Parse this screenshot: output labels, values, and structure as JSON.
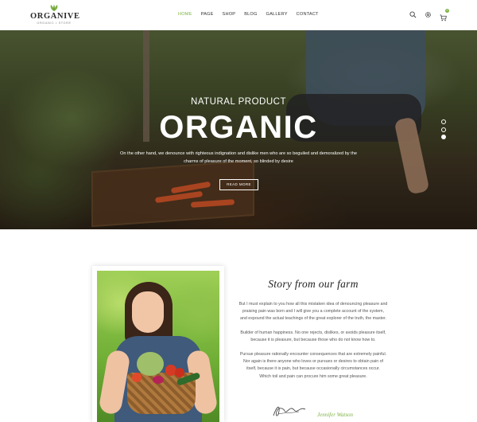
{
  "brand": {
    "name": "ORGANIVE",
    "tagline": "ORGANIC • STORE"
  },
  "nav": {
    "items": [
      {
        "label": "HOME",
        "active": true
      },
      {
        "label": "PAGE"
      },
      {
        "label": "SHOP"
      },
      {
        "label": "BLOG"
      },
      {
        "label": "GALLERY"
      },
      {
        "label": "CONTACT"
      }
    ]
  },
  "header_icons": [
    "search-icon",
    "gear-icon",
    "cart-icon"
  ],
  "cart": {
    "count": "0"
  },
  "hero": {
    "subtitle": "NATURAL PRODUCT",
    "title": "ORGANIC",
    "text": "On the other hand, we denounce with righteous indignation and dislike men who are so beguiled and demoralized by the charms of pleasure of the moment, so blinded by desire",
    "button": "READ MORE",
    "slides": 3,
    "active_slide": 3
  },
  "story": {
    "title": "Story from our farm",
    "p1": "But I must explain to you how all this mistaken idea of denouncing pleasure and praising pain was born and I will give you a complete account of the system, and expound the actual teachings of the great explorer of the truth, the master.",
    "p2": "Builder of human happiness. No one rejects, dislikes, or avoids pleasure itself, because it is pleasure, but because those who do not know how to.",
    "p3": "Pursue pleasure rationally encounter consequences that are extremely painful. Nor again is there anyone who loves or pursues or desires to obtain pain of itself, because it is pain, but because occasionally circumstances occur.",
    "p4": "Which toil and pain can procure him some great pleasure.",
    "author": "Jennifer Watson"
  },
  "colors": {
    "accent": "#7cb342",
    "text": "#333333"
  }
}
